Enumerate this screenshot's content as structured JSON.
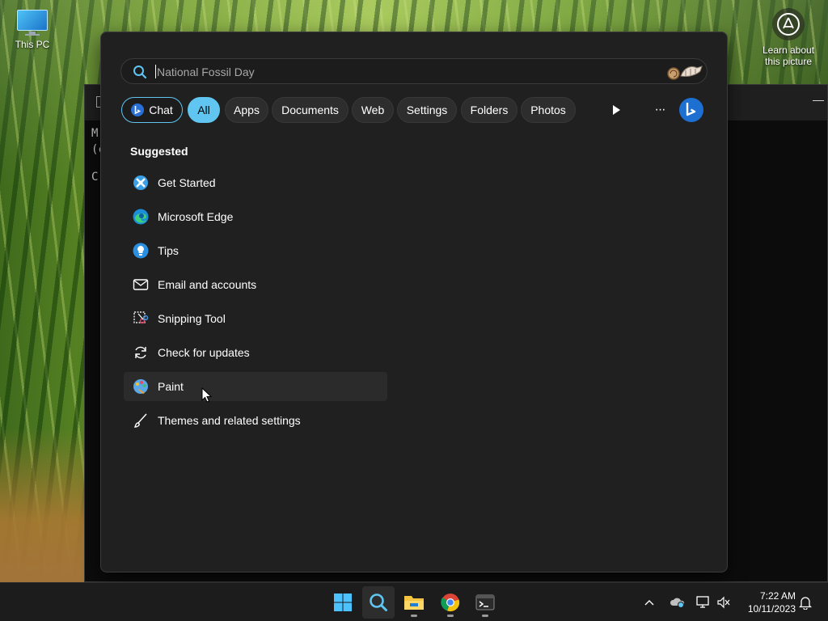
{
  "desktop": {
    "icon_label": "This PC",
    "learn_label_line1": "Learn about",
    "learn_label_line2": "this picture"
  },
  "terminal": {
    "line1": "M:",
    "line2": "(c",
    "line3": "C:"
  },
  "search": {
    "placeholder": "National Fossil Day"
  },
  "filters": {
    "chat": "Chat",
    "all": "All",
    "apps": "Apps",
    "documents": "Documents",
    "web": "Web",
    "settings": "Settings",
    "folders": "Folders",
    "photos": "Photos",
    "more": "···"
  },
  "suggested": {
    "title": "Suggested",
    "items": [
      {
        "label": "Get Started",
        "icon": "get-started-icon"
      },
      {
        "label": "Microsoft Edge",
        "icon": "edge-icon"
      },
      {
        "label": "Tips",
        "icon": "tips-icon"
      },
      {
        "label": "Email and accounts",
        "icon": "mail-icon"
      },
      {
        "label": "Snipping Tool",
        "icon": "snipping-tool-icon"
      },
      {
        "label": "Check for updates",
        "icon": "refresh-icon"
      },
      {
        "label": "Paint",
        "icon": "paint-icon"
      },
      {
        "label": "Themes and related settings",
        "icon": "brush-icon"
      }
    ]
  },
  "taskbar": {
    "time": "7:22 AM",
    "date": "10/11/2023",
    "apps": [
      "start-icon",
      "search-icon",
      "file-explorer-icon",
      "chrome-icon",
      "terminal-icon"
    ]
  },
  "colors": {
    "accent": "#60c5f1",
    "panel_bg": "#202020",
    "taskbar_bg": "#1c1c1c"
  }
}
